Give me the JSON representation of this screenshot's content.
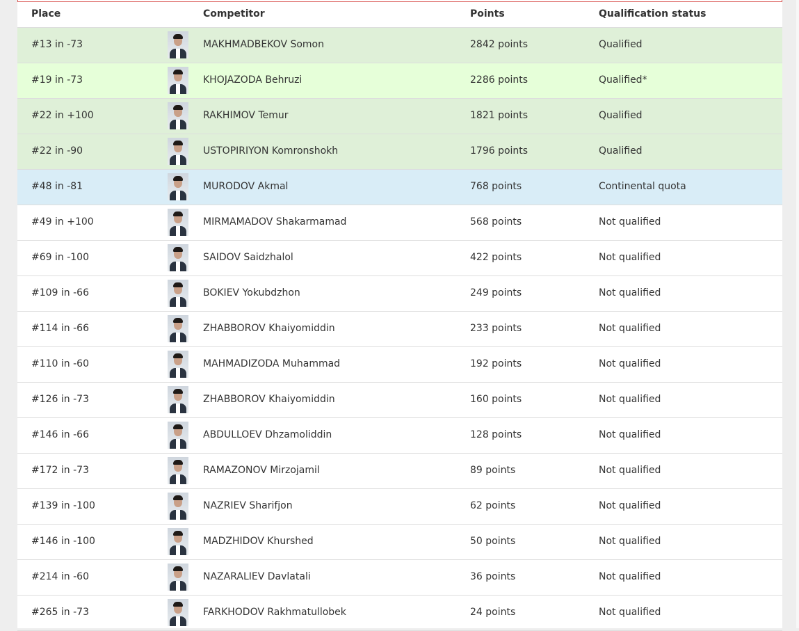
{
  "table": {
    "headers": {
      "place": "Place",
      "competitor": "Competitor",
      "points": "Points",
      "status": "Qualification status"
    },
    "rows": [
      {
        "place": "#13 in -73",
        "name": "MAKHMADBEKOV Somon",
        "points": "2842 points",
        "status": "Qualified",
        "highlight": "green"
      },
      {
        "place": "#19 in -73",
        "name": "KHOJAZODA Behruzi",
        "points": "2286 points",
        "status": "Qualified*",
        "highlight": "green-light"
      },
      {
        "place": "#22 in +100",
        "name": "RAKHIMOV Temur",
        "points": "1821 points",
        "status": "Qualified",
        "highlight": "green"
      },
      {
        "place": "#22 in -90",
        "name": "USTOPIRIYON Komronshokh",
        "points": "1796 points",
        "status": "Qualified",
        "highlight": "green"
      },
      {
        "place": "#48 in -81",
        "name": "MURODOV Akmal",
        "points": "768 points",
        "status": "Continental quota",
        "highlight": "blue"
      },
      {
        "place": "#49 in +100",
        "name": "MIRMAMADOV Shakarmamad",
        "points": "568 points",
        "status": "Not qualified",
        "highlight": "none"
      },
      {
        "place": "#69 in -100",
        "name": "SAIDOV Saidzhalol",
        "points": "422 points",
        "status": "Not qualified",
        "highlight": "none"
      },
      {
        "place": "#109 in -66",
        "name": "BOKIEV Yokubdzhon",
        "points": "249 points",
        "status": "Not qualified",
        "highlight": "none"
      },
      {
        "place": "#114 in -66",
        "name": "ZHABBOROV Khaiyomiddin",
        "points": "233 points",
        "status": "Not qualified",
        "highlight": "none"
      },
      {
        "place": "#110 in -60",
        "name": "MAHMADIZODA Muhammad",
        "points": "192 points",
        "status": "Not qualified",
        "highlight": "none"
      },
      {
        "place": "#126 in -73",
        "name": "ZHABBOROV Khaiyomiddin",
        "points": "160 points",
        "status": "Not qualified",
        "highlight": "none"
      },
      {
        "place": "#146 in -66",
        "name": "ABDULLOEV Dhzamoliddin",
        "points": "128 points",
        "status": "Not qualified",
        "highlight": "none"
      },
      {
        "place": "#172 in -73",
        "name": "RAMAZONOV Mirzojamil",
        "points": "89 points",
        "status": "Not qualified",
        "highlight": "none"
      },
      {
        "place": "#139 in -100",
        "name": "NAZRIEV Sharifjon",
        "points": "62 points",
        "status": "Not qualified",
        "highlight": "none"
      },
      {
        "place": "#146 in -100",
        "name": "MADZHIDOV Khurshed",
        "points": "50 points",
        "status": "Not qualified",
        "highlight": "none"
      },
      {
        "place": "#214 in -60",
        "name": "NAZARALIEV Davlatali",
        "points": "36 points",
        "status": "Not qualified",
        "highlight": "none"
      },
      {
        "place": "#265 in -73",
        "name": "FARKHODOV Rakhmatullobek",
        "points": "24 points",
        "status": "Not qualified",
        "highlight": "none"
      }
    ]
  },
  "colors": {
    "green": "#dff0d8",
    "green_light": "#e6ffd9",
    "blue": "#d9edf7",
    "border_accent": "#d9534f"
  },
  "icons": {
    "avatar": "person-photo-icon"
  }
}
